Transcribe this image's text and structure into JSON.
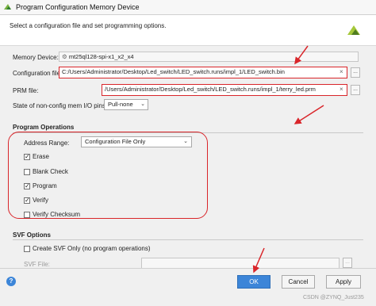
{
  "window": {
    "title": "Program Configuration Memory Device"
  },
  "header": {
    "subtitle": "Select a configuration file and set programming options."
  },
  "memory_device": {
    "label": "Memory Device:",
    "value": "mt25ql128-spi-x1_x2_x4"
  },
  "configuration_file": {
    "label": "Configuration file:",
    "value": "C:/Users/Administrator/Desktop/Led_switch/LED_switch.runs/impl_1/LED_switch.bin"
  },
  "prm_file": {
    "label": "PRM file:",
    "value": "/Users/Administrator/Desktop/Led_switch/LED_switch.runs/impl_1/terry_led.prm"
  },
  "state_pins": {
    "label": "State of non-config mem I/O pins:",
    "value": "Pull-none"
  },
  "program_operations": {
    "title": "Program Operations",
    "address_range_label": "Address Range:",
    "address_range_value": "Configuration File Only",
    "options": [
      {
        "label": "Erase",
        "checked": true
      },
      {
        "label": "Blank Check",
        "checked": false
      },
      {
        "label": "Program",
        "checked": true
      },
      {
        "label": "Verify",
        "checked": true
      },
      {
        "label": "Verify Checksum",
        "checked": false
      }
    ]
  },
  "svf_options": {
    "title": "SVF Options",
    "create_svf_label": "Create SVF Only (no program operations)",
    "svf_file_label": "SVF File:"
  },
  "buttons": {
    "ok": "OK",
    "cancel": "Cancel",
    "apply": "Apply",
    "browse": "...",
    "clear": "×"
  },
  "watermark": "CSDN @ZYNQ_Just235",
  "colors": {
    "accent": "#3c85d8",
    "annotation_red": "#d9252a"
  }
}
